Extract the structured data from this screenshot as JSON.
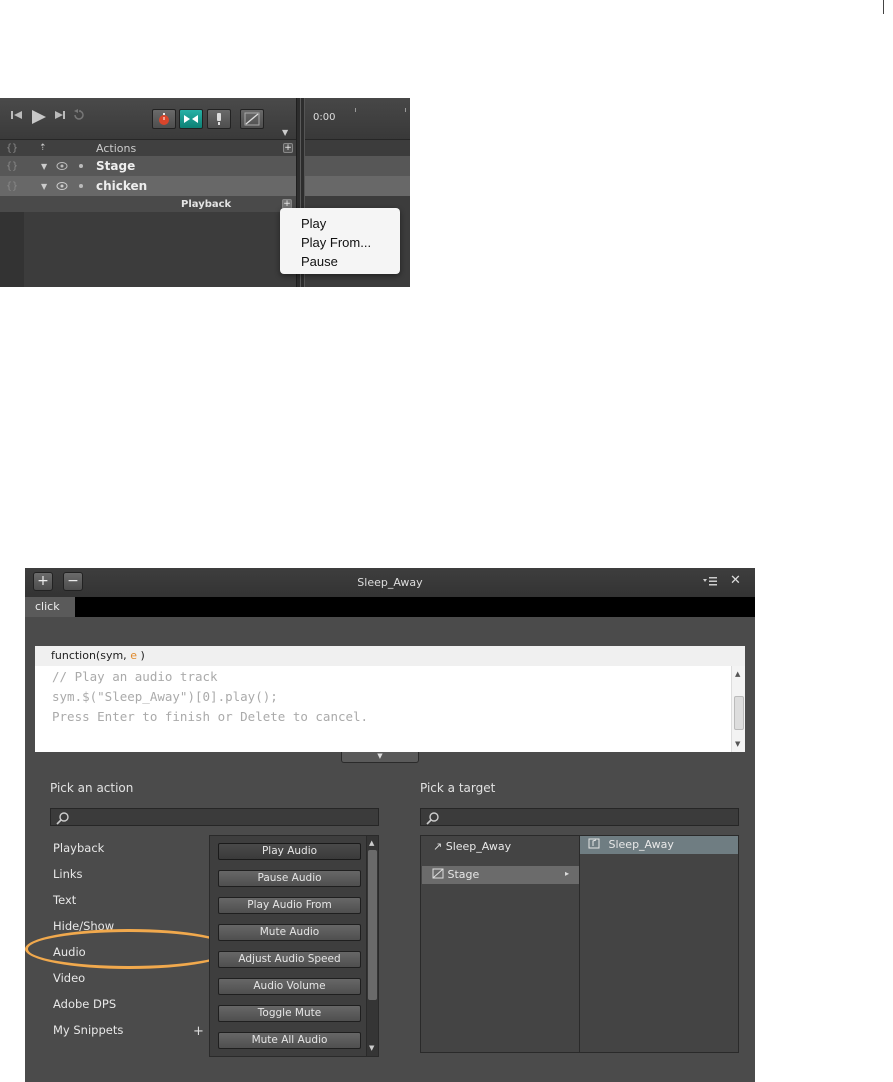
{
  "timeline": {
    "time_readout": "0:00",
    "tools": [
      "stopwatch-icon",
      "pin-icon",
      "key-icon",
      "easing-icon"
    ],
    "layers": [
      {
        "name": "Actions"
      },
      {
        "name": "Stage"
      },
      {
        "name": "chicken"
      }
    ],
    "track_label": "Playback",
    "playback_menu": [
      "Play",
      "Play From...",
      "Pause"
    ]
  },
  "dialog": {
    "title": "Sleep_Away",
    "tab": "click",
    "function_signature": "function(sym, ",
    "function_param": "e",
    "function_close": " )",
    "code_lines": [
      "// Play an audio track",
      "sym.$(\"Sleep_Away\")[0].play();",
      "Press Enter to finish or Delete to cancel."
    ],
    "pick_action_label": "Pick an action",
    "pick_target_label": "Pick a target",
    "categories": [
      "Playback",
      "Links",
      "Text",
      "Hide/Show",
      "Audio",
      "Video",
      "Adobe DPS",
      "My Snippets"
    ],
    "actions": [
      "Play Audio",
      "Pause Audio",
      "Play Audio From",
      "Mute Audio",
      "Adjust Audio Speed",
      "Audio Volume",
      "Toggle Mute",
      "Mute All Audio"
    ],
    "targets": [
      "Sleep_Away",
      "Stage"
    ],
    "target_children": [
      "Sleep_Away"
    ],
    "highlight_color": "#f1a94d"
  }
}
